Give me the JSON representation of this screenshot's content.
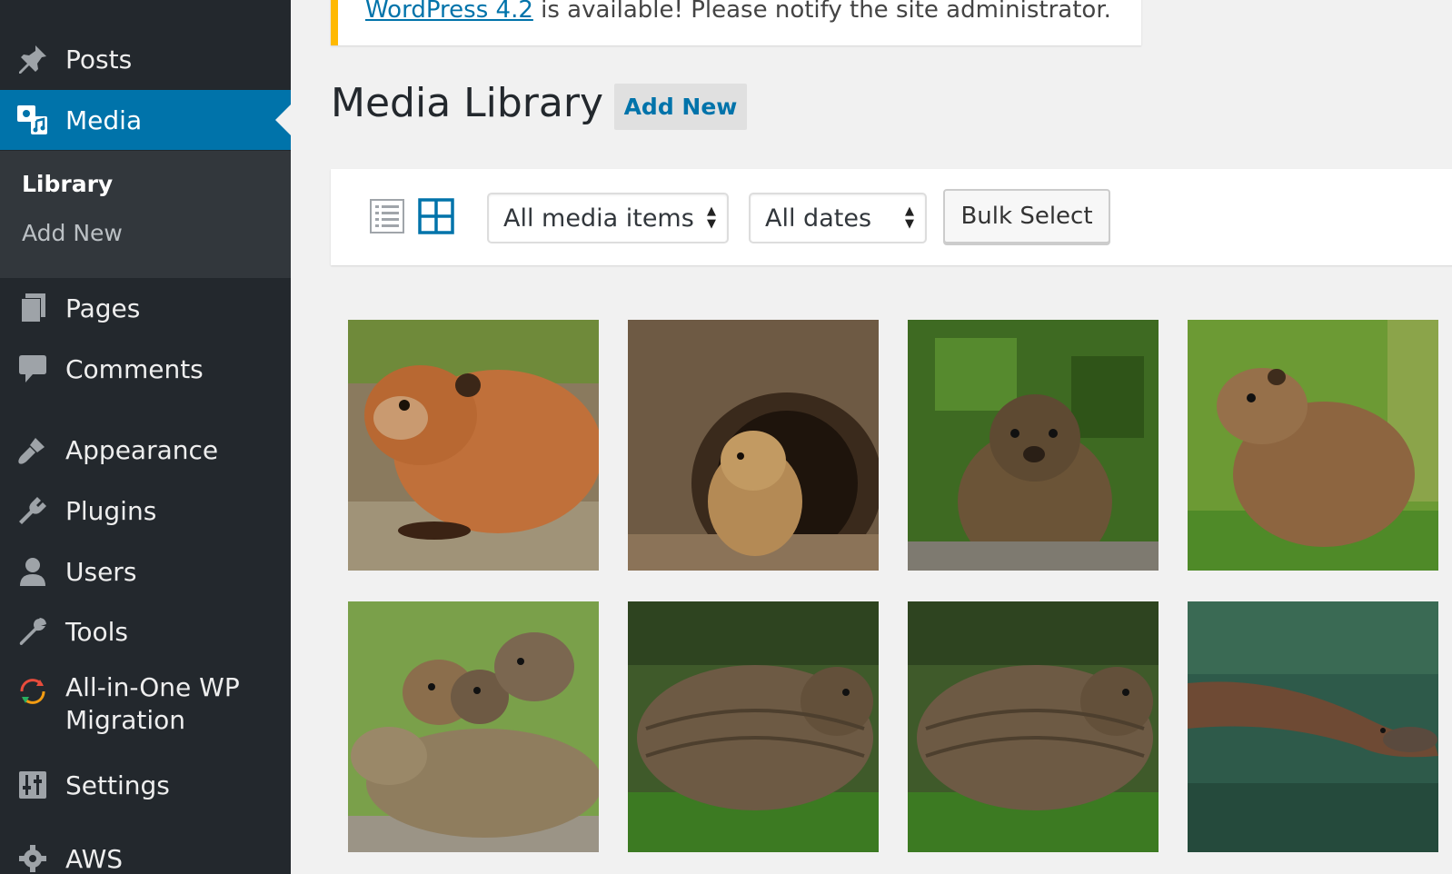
{
  "sidebar": {
    "items": [
      {
        "label": "Posts",
        "icon": "pin-icon"
      },
      {
        "label": "Media",
        "icon": "media-icon",
        "current": true
      },
      {
        "label": "Pages",
        "icon": "pages-icon"
      },
      {
        "label": "Comments",
        "icon": "comment-icon"
      },
      {
        "label": "Appearance",
        "icon": "paintbrush-icon"
      },
      {
        "label": "Plugins",
        "icon": "plugin-icon"
      },
      {
        "label": "Users",
        "icon": "user-icon"
      },
      {
        "label": "Tools",
        "icon": "wrench-icon"
      },
      {
        "label_line1": "All-in-One WP",
        "label_line2": "Migration",
        "icon": "migration-icon"
      },
      {
        "label": "Settings",
        "icon": "settings-icon"
      },
      {
        "label": "AWS",
        "icon": "gear-icon"
      }
    ],
    "submenu": {
      "library": "Library",
      "add_new": "Add New"
    },
    "colors": {
      "background": "#23282d",
      "current": "#0073aa",
      "submenu": "#32373c"
    }
  },
  "notice": {
    "link_text": "WordPress 4.2",
    "text": " is available! Please notify the site administrator.",
    "accent": "#ffb900"
  },
  "header": {
    "title": "Media Library",
    "add_new_label": "Add New"
  },
  "toolbar": {
    "view_modes": [
      "list-view-icon",
      "grid-view-icon"
    ],
    "active_view": "grid",
    "media_filter": "All media items",
    "date_filter": "All dates",
    "bulk_select_label": "Bulk Select"
  },
  "grid": {
    "items": [
      {
        "subject": "groundhog-on-rocks"
      },
      {
        "subject": "prairie-dog-in-burrow"
      },
      {
        "subject": "groundhog-front-facing"
      },
      {
        "subject": "groundhog-in-grass"
      },
      {
        "subject": "groundhog-with-babies"
      },
      {
        "subject": "groundhog-walking"
      },
      {
        "subject": "groundhog-walking"
      },
      {
        "subject": "platypus-swimming"
      }
    ]
  }
}
